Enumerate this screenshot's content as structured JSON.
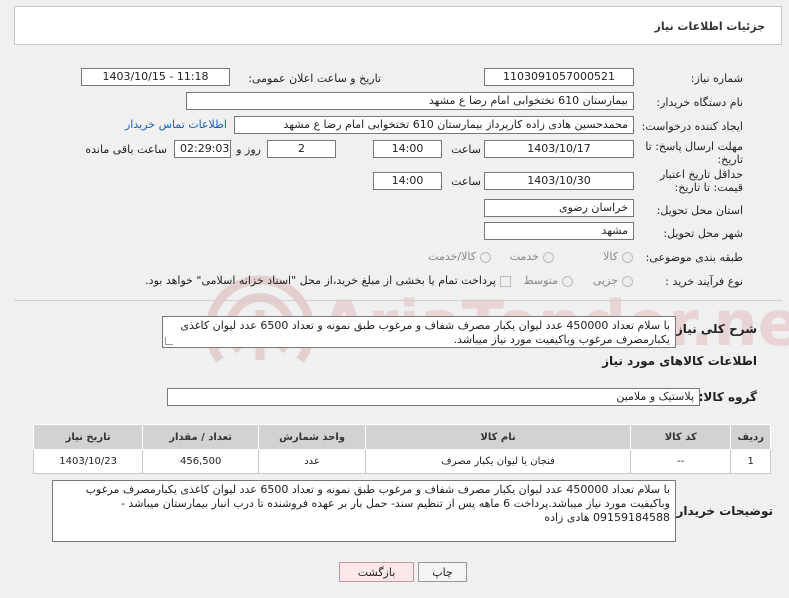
{
  "panel": {
    "title": "جزئیات اطلاعات نیاز"
  },
  "labels": {
    "need_number": "شماره نیاز:",
    "announce_datetime": "تاریخ و ساعت اعلان عمومی:",
    "buyer_org": "نام دستگاه خریدار:",
    "requester": "ایجاد کننده درخواست:",
    "reply_deadline": "مهلت ارسال پاسخ: تا تاریخ:",
    "time": "ساعت",
    "day_and": "روز و",
    "hours_remaining": "ساعت باقی مانده",
    "price_validity": "حداقل تاریخ اعتبار قیمت: تا تاریخ:",
    "province": "استان محل تحویل:",
    "city": "شهر محل تحویل:",
    "category": "طبقه بندی موضوعی:",
    "purchase_type": "نوع فرآیند خرید :",
    "need_desc": "شرح کلی نیاز:",
    "goods_info": "اطلاعات کالاهای مورد نیاز",
    "goods_group": "گروه کالا:",
    "buyer_notes": "توضیحات خریدار:"
  },
  "fields": {
    "need_number": "1103091057000521",
    "announce_datetime": "1403/10/15 - 11:18",
    "buyer_org": "بیمارستان 610 تختخوابی امام رضا ع  مشهد",
    "requester": "محمدحسین هادی زاده کارپرداز بیمارستان 610 تختخوابی امام رضا ع  مشهد",
    "contact_link": "اطلاعات تماس خریدار",
    "reply_date": "1403/10/17",
    "reply_time": "14:00",
    "days": "2",
    "remaining": "02:29:03",
    "validity_date": "1403/10/30",
    "validity_time": "14:00",
    "province": "خراسان رضوی",
    "city": "مشهد",
    "goods_group": "پلاستیک و ملامین"
  },
  "category_options": [
    "کالا",
    "خدمت",
    "کالا/خدمت"
  ],
  "purchase_options": [
    "جزیی",
    "متوسط"
  ],
  "payment_note": "پرداخت تمام یا بخشی از مبلغ خرید،از محل \"اسناد خزانه اسلامی\" خواهد بود.",
  "need_description": "با سلام تعداد 450000 عدد لیوان یکبار مصرف شفاف و مرغوب طبق نمونه و تعداد 6500 عدد لیوان کاغذی یکبارمصرف مرغوب  وباکیفیت مورد نیاز میباشد.",
  "table": {
    "headers": [
      "ردیف",
      "کد کالا",
      "نام کالا",
      "واحد شمارش",
      "تعداد / مقدار",
      "تاریخ نیاز"
    ],
    "rows": [
      [
        "1",
        "--",
        "فنجان یا لیوان یکبار مصرف",
        "عدد",
        "456,500",
        "1403/10/23"
      ]
    ]
  },
  "buyer_notes": "با سلام تعداد 450000 عدد لیوان یکبار مصرف شفاف و مرغوب طبق نمونه و تعداد 6500 عدد لیوان کاغذی یکبارمصرف مرغوب  وباکیفیت مورد نیاز میباشد.پرداخت 6 ماهه پس از تنظیم سند- حمل بار بر عهده فروشنده تا درب انبار بیمارستان میباشد - 09159184588 هادی زاده",
  "buttons": {
    "print": "چاپ",
    "back": "بازگشت"
  },
  "watermark": {
    "text": "AriaTender.neT"
  }
}
